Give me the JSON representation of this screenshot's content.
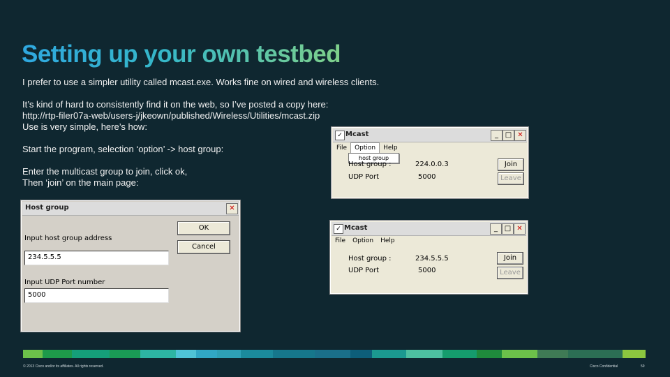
{
  "slide": {
    "title": "Setting up your own testbed",
    "paragraphs": [
      "I prefer to use a simpler utility called mcast.exe.  Works fine on wired and wireless clients.",
      "It’s kind of hard to consistently find it on the web, so I’ve posted a copy here:",
      "http://rtp-filer07a-web/users-j/jkeown/published/Wireless/Utilities/mcast.zip",
      "Use is very simple, here’s how:",
      "Start the program, selection ‘option’ -> host group:",
      "Enter the multicast group to join, click ok,",
      "Then ‘join’ on the main page:"
    ]
  },
  "mcast_window_top": {
    "title": "Mcast",
    "menu": [
      "File",
      "Option",
      "Help"
    ],
    "dropdown_item": "host group",
    "host_group_label": "Host group :",
    "host_group_value": "224.0.0.3",
    "udp_port_label": "UDP Port",
    "udp_port_value": "5000",
    "join_label": "Join",
    "leave_label": "Leave"
  },
  "host_group_dialog": {
    "title": "Host group",
    "ok_label": "OK",
    "cancel_label": "Cancel",
    "address_label": "Input host group address",
    "address_value": "234.5.5.5",
    "port_label": "Input UDP Port number",
    "port_value": "5000"
  },
  "mcast_window_bottom": {
    "title": "Mcast",
    "menu": [
      "File",
      "Option",
      "Help"
    ],
    "host_group_label": "Host group :",
    "host_group_value": "234.5.5.5",
    "udp_port_label": "UDP Port",
    "udp_port_value": "5000",
    "join_label": "Join",
    "leave_label": "Leave"
  },
  "footer": {
    "copyright": "© 2013  Cisco and/or its affiliates. All rights reserved.",
    "confidential": "Cisco Confidential",
    "page_number": "59"
  },
  "colors": {
    "background": "#0f2730",
    "strip": [
      "#6cc04a",
      "#1e9a4a",
      "#159f7a",
      "#1a9a55",
      "#2db5a3",
      "#4fc3d6",
      "#31a7c5",
      "#2ea0b6",
      "#1b8a9c",
      "#16778c",
      "#1a6f8a",
      "#0d5e7a",
      "#1b9990",
      "#4dbfa0",
      "#159c6d",
      "#1f8a3c",
      "#6cc04a",
      "#3f7a55",
      "#2c6e54",
      "#8cc63f"
    ]
  }
}
